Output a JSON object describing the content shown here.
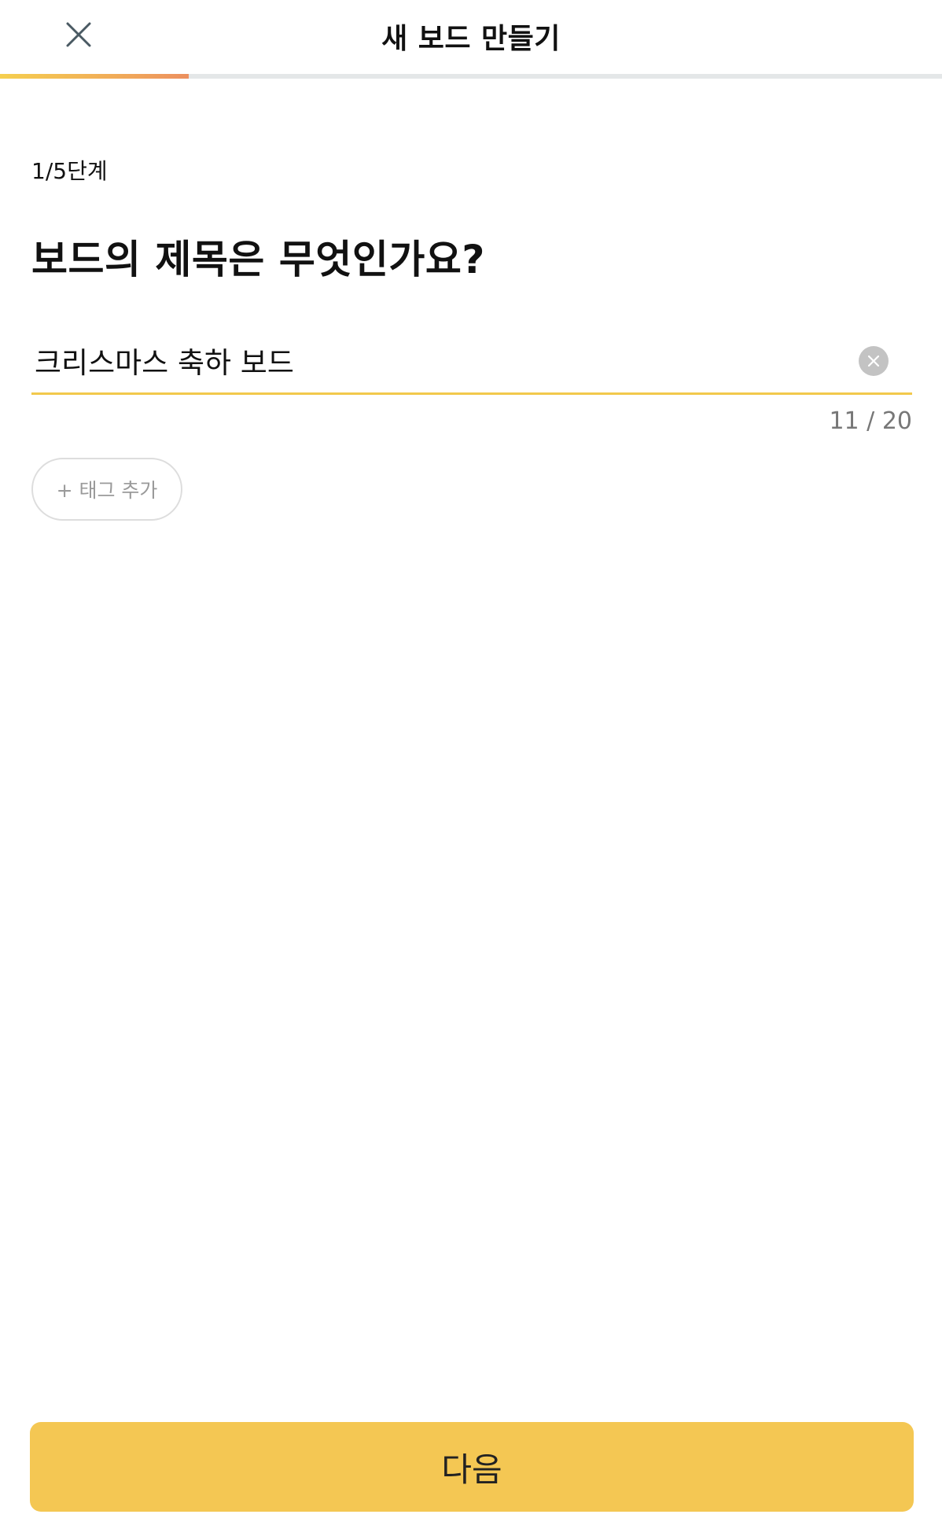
{
  "header": {
    "title": "새 보드 만들기",
    "close_icon": "close-icon"
  },
  "progress": {
    "fraction": 0.2
  },
  "step": {
    "label": "1/5단계"
  },
  "question": "보드의 제목은 무엇인가요?",
  "title_field": {
    "value": "크리스마스 축하 보드",
    "clear_icon": "clear-circle-icon",
    "char_count": "11 / 20"
  },
  "tag_button": {
    "label": "+ 태그 추가"
  },
  "footer": {
    "next_label": "다음"
  },
  "colors": {
    "accent": "#f4c753",
    "underline": "#f2c94c",
    "progress_start": "#f5cf4f",
    "progress_end": "#ec8f5f"
  }
}
